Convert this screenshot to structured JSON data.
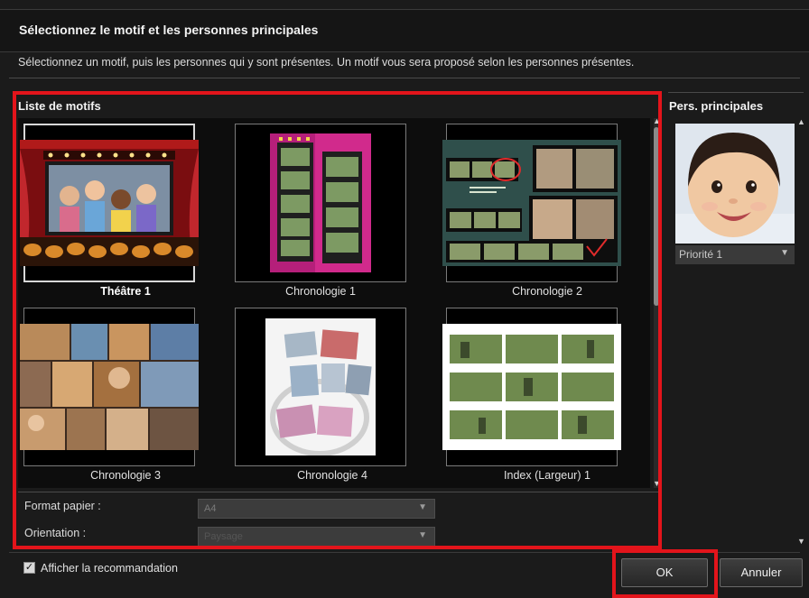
{
  "dialog": {
    "title": "Sélectionnez le motif et les personnes principales",
    "description": "Sélectionnez un motif, puis les personnes qui y sont présentes. Un motif vous sera proposé selon les personnes présentes."
  },
  "motif_list": {
    "title": "Liste de motifs",
    "selected_index": 0,
    "items": [
      {
        "label": "Théâtre 1"
      },
      {
        "label": "Chronologie 1"
      },
      {
        "label": "Chronologie 2"
      },
      {
        "label": "Chronologie 3"
      },
      {
        "label": "Chronologie 4"
      },
      {
        "label": "Index (Largeur) 1"
      }
    ]
  },
  "form": {
    "paper_format_label": "Format papier :",
    "paper_format_value": "A4",
    "orientation_label": "Orientation :",
    "orientation_value": "Paysage"
  },
  "persons": {
    "title": "Pers. principales",
    "priority_value": "Priorité 1"
  },
  "footer": {
    "show_recommendation_label": "Afficher la recommandation",
    "show_recommendation_checked": true,
    "ok_label": "OK",
    "cancel_label": "Annuler"
  },
  "colors": {
    "highlight": "#e3141b",
    "background": "#1b1b1b"
  },
  "icons": {
    "scroll_up": "scroll-up-arrow-icon",
    "scroll_down": "scroll-down-arrow-icon",
    "dropdown": "chevron-down-icon",
    "checkbox": "checkmark-icon"
  }
}
